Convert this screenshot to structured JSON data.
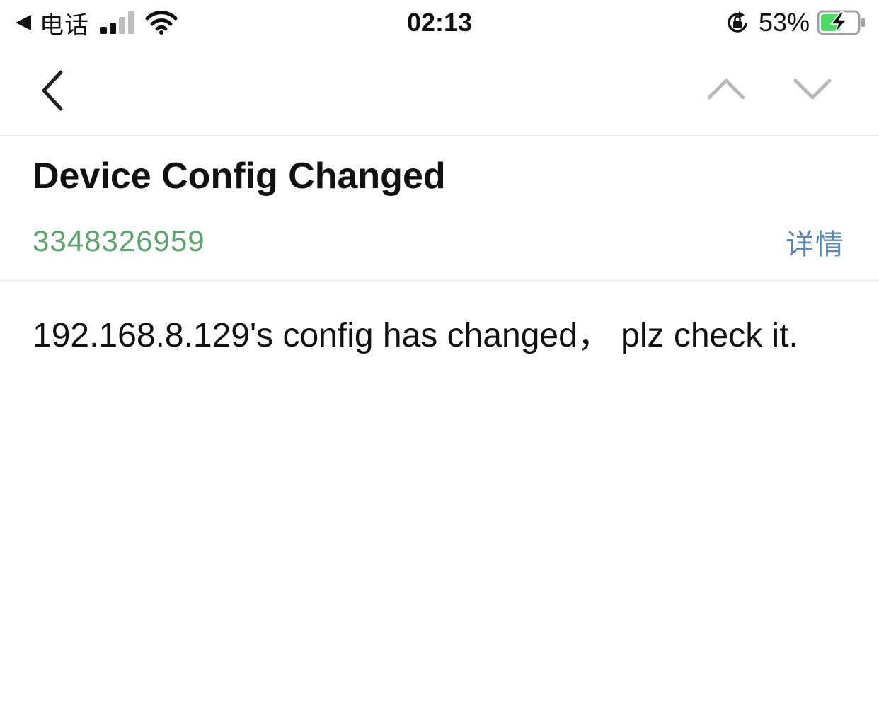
{
  "status_bar": {
    "back_app_label": "电话",
    "time": "02:13",
    "battery_percent": "53%",
    "battery_level": 0.53,
    "signal_bars": 2,
    "charging": true,
    "icons": {
      "back": "back-arrow-icon",
      "signal": "cellular-signal-icon",
      "wifi": "wifi-icon",
      "rotation_lock": "rotation-lock-icon",
      "battery": "battery-charging-icon"
    }
  },
  "nav": {
    "icons": {
      "back": "chevron-left-icon",
      "prev": "chevron-up-icon",
      "next": "chevron-down-icon"
    }
  },
  "message": {
    "title": "Device Config Changed",
    "sender": "3348326959",
    "detail_link": "详情",
    "body": "192.168.8.129's config has changed， plz check it."
  },
  "colors": {
    "sender_green": "#5ca36c",
    "link_blue": "#5b87b3",
    "battery_green": "#4cd964",
    "disabled_gray": "#b8b8b8",
    "divider": "#e6e6e6"
  }
}
